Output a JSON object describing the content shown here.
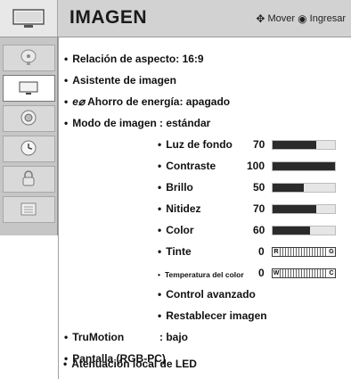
{
  "header": {
    "title": "IMAGEN",
    "move_label": "Mover",
    "enter_label": "Ingresar"
  },
  "sidebar": {
    "items": [
      {
        "icon": "satellite-dish-icon",
        "active": false
      },
      {
        "icon": "tv-picture-icon",
        "active": true
      },
      {
        "icon": "speaker-icon",
        "active": false
      },
      {
        "icon": "clock-icon",
        "active": false
      },
      {
        "icon": "lock-icon",
        "active": false
      },
      {
        "icon": "input-icon",
        "active": false
      }
    ]
  },
  "menu": {
    "aspect_ratio": {
      "label": "Relación de aspecto",
      "value": ": 16:9"
    },
    "picture_wizard": {
      "label": "Asistente de imagen"
    },
    "energy_saving": {
      "label": "Ahorro de energía",
      "value": ": apagado"
    },
    "picture_mode": {
      "label": "Modo de imagen",
      "value": ": estándar"
    },
    "sub": {
      "backlight": {
        "label": "Luz de fondo",
        "value": "70",
        "level": 0.7
      },
      "contrast": {
        "label": "Contraste",
        "value": "100",
        "level": 1.0
      },
      "brightness": {
        "label": "Brillo",
        "value": "50",
        "level": 0.5
      },
      "sharpness": {
        "label": "Nitidez",
        "value": "70",
        "level": 0.7
      },
      "color": {
        "label": "Color",
        "value": "60",
        "level": 0.6
      },
      "tint": {
        "label": "Tinte",
        "value": "0",
        "left": "R",
        "right": "G"
      },
      "color_temp": {
        "label": "Temperatura del color",
        "value": "0",
        "left": "W",
        "right": "C"
      },
      "advanced": {
        "label": "Control avanzado"
      },
      "reset": {
        "label": "Restablecer imagen"
      }
    },
    "trumotion": {
      "label": "TruMotion",
      "value": ": bajo"
    },
    "screen": {
      "label": "Pantalla (RGB-PC)"
    },
    "led_dimming": {
      "label": "Atenuación local de LED"
    }
  }
}
